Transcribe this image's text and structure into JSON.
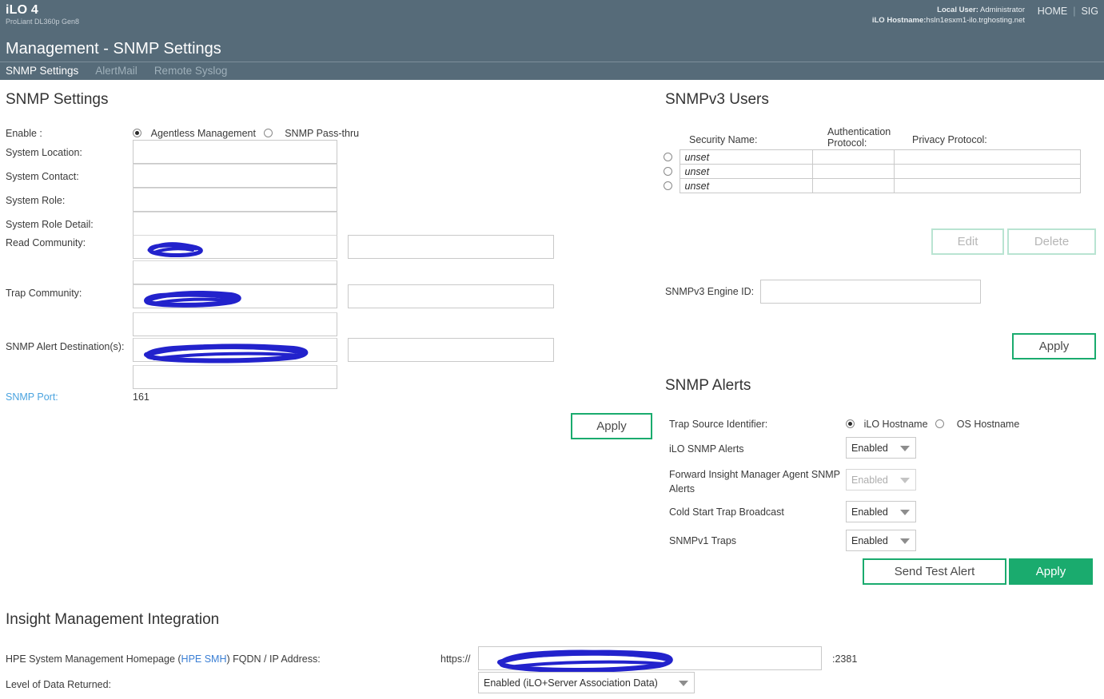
{
  "header": {
    "product": "iLO 4",
    "model": "ProLiant DL360p Gen8",
    "local_user_label": "Local User:",
    "local_user_value": "Administrator",
    "hostname_label": "iLO Hostname:",
    "hostname_value": "hsln1esxm1-ilo.trghosting.net",
    "nav": {
      "home": "HOME",
      "separator": "|",
      "signout": "SIG"
    }
  },
  "page": {
    "title": "Management - SNMP Settings",
    "tabs": [
      {
        "label": "SNMP Settings",
        "active": true
      },
      {
        "label": "AlertMail",
        "active": false
      },
      {
        "label": "Remote Syslog",
        "active": false
      }
    ]
  },
  "snmp_settings": {
    "heading": "SNMP Settings",
    "enable_label": "Enable :",
    "enable_options": [
      {
        "label": "Agentless Management",
        "selected": true
      },
      {
        "label": "SNMP Pass-thru",
        "selected": false
      }
    ],
    "fields": [
      {
        "label": "System Location:",
        "value": ""
      },
      {
        "label": "System Contact:",
        "value": ""
      },
      {
        "label": "System Role:",
        "value": ""
      },
      {
        "label": "System Role Detail:",
        "value": ""
      }
    ],
    "read_community_label": "Read Community:",
    "read_community_value": "[redacted]",
    "read_community_value_2": "",
    "read_community_alt": "",
    "trap_community_label": "Trap Community:",
    "trap_community_value": "[redacted]",
    "trap_community_value_2": "",
    "trap_community_alt": "",
    "alert_dest_label": "SNMP Alert Destination(s):",
    "alert_dest_value": "[redacted]",
    "alert_dest_value_2": "",
    "alert_dest_alt": "",
    "snmp_port_label": "SNMP Port:",
    "snmp_port_value": "161",
    "apply_label": "Apply"
  },
  "snmpv3_users": {
    "heading": "SNMPv3 Users",
    "columns": {
      "security_name": "Security Name:",
      "auth_protocol_line1": "Authentication",
      "auth_protocol_line2": "Protocol:",
      "privacy_protocol": "Privacy Protocol:"
    },
    "rows": [
      {
        "selected": false,
        "security_name": "unset",
        "auth_protocol": "",
        "privacy_protocol": ""
      },
      {
        "selected": false,
        "security_name": "unset",
        "auth_protocol": "",
        "privacy_protocol": ""
      },
      {
        "selected": false,
        "security_name": "unset",
        "auth_protocol": "",
        "privacy_protocol": ""
      }
    ],
    "edit_label": "Edit",
    "delete_label": "Delete",
    "engine_id_label": "SNMPv3 Engine ID:",
    "engine_id_value": "",
    "apply_label": "Apply"
  },
  "snmp_alerts": {
    "heading": "SNMP Alerts",
    "trap_source_label": "Trap Source Identifier:",
    "trap_source_options": [
      {
        "label": "iLO Hostname",
        "selected": true
      },
      {
        "label": "OS Hostname",
        "selected": false
      }
    ],
    "items": [
      {
        "label": "iLO SNMP Alerts",
        "value": "Enabled",
        "disabled": false
      },
      {
        "label": "Forward Insight Manager Agent SNMP Alerts",
        "value": "Enabled",
        "disabled": true
      },
      {
        "label": "Cold Start Trap Broadcast",
        "value": "Enabled",
        "disabled": false
      },
      {
        "label": "SNMPv1 Traps",
        "value": "Enabled",
        "disabled": false
      }
    ],
    "send_test_label": "Send Test Alert",
    "apply_label": "Apply"
  },
  "insight": {
    "heading": "Insight Management Integration",
    "smh_label_pre": "HPE System Management Homepage (",
    "smh_link": "HPE SMH",
    "smh_label_post": ") FQDN / IP Address:",
    "scheme": "https://",
    "smh_value": "[redacted]",
    "port_suffix": ":2381",
    "level_label": "Level of Data Returned:",
    "level_value": "Enabled (iLO+Server Association Data)"
  },
  "colors": {
    "header_bg": "#566b79",
    "accent_green": "#1aab6e",
    "link_blue": "#4aa3df",
    "redaction": "#2222cc"
  }
}
